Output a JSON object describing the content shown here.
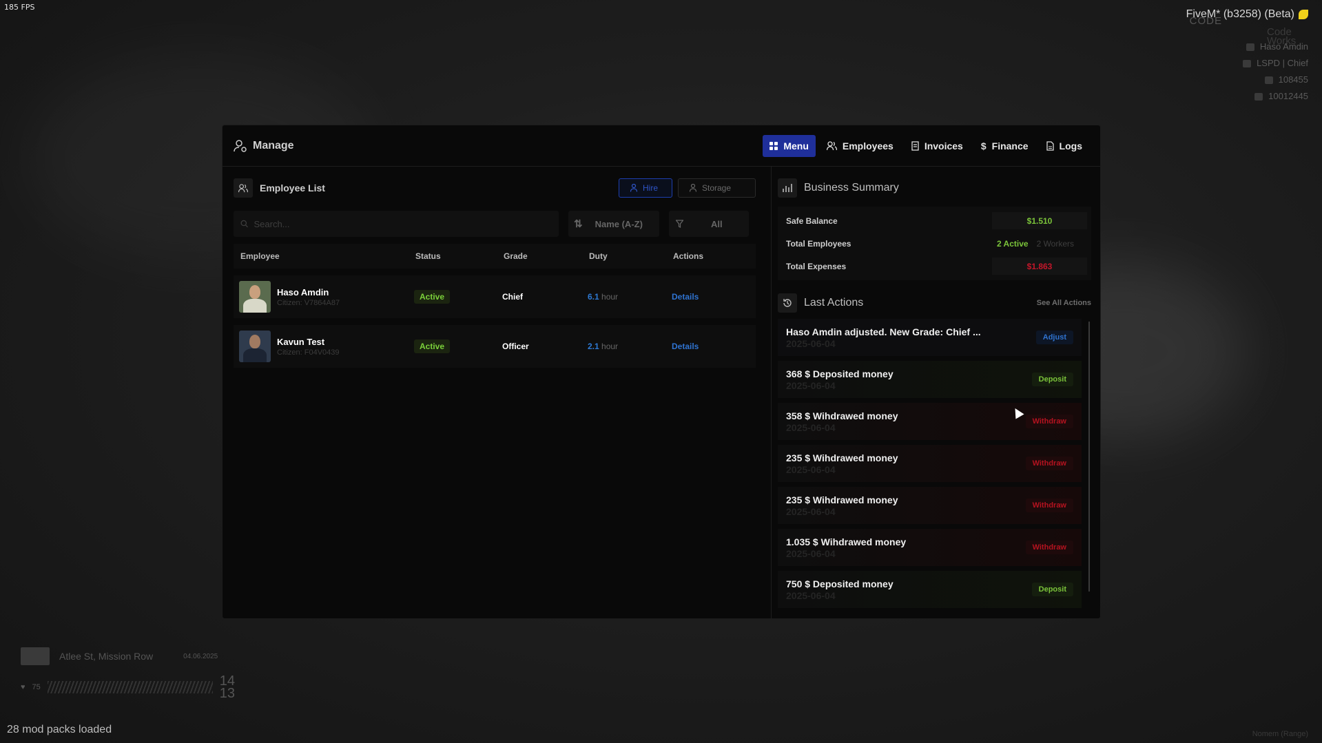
{
  "hud": {
    "fps": "185 FPS",
    "title": "FiveM* (b3258) (Beta)",
    "code_label": "CODE",
    "works_label": "Code Works",
    "player_name": "Haso Amdin",
    "job": "LSPD | Chief",
    "bank": "108455",
    "cash": "10012445",
    "street": "Atlee St, Mission Row",
    "date": "04.06.2025",
    "health": "75",
    "hunger": "14",
    "thirst": "13",
    "mods_loaded": "28 mod packs loaded",
    "native_label": "Nomem (Range)"
  },
  "panel": {
    "title": "Manage",
    "nav": [
      {
        "label": "Menu",
        "icon": "grid-icon",
        "active": true
      },
      {
        "label": "Employees",
        "icon": "users-icon",
        "active": false
      },
      {
        "label": "Invoices",
        "icon": "receipt-icon",
        "active": false
      },
      {
        "label": "Finance",
        "icon": "dollar-icon",
        "active": false
      },
      {
        "label": "Logs",
        "icon": "file-icon",
        "active": false
      }
    ]
  },
  "employee_list": {
    "title": "Employee List",
    "hire_label": "Hire",
    "storage_label": "Storage",
    "search_placeholder": "Search...",
    "sort_label": "Name (A-Z)",
    "filter_label": "All",
    "columns": [
      "Employee",
      "Status",
      "Grade",
      "Duty",
      "Actions"
    ],
    "rows": [
      {
        "name": "Haso Amdin",
        "citizen": "Citizen: V7864A87",
        "status": "Active",
        "grade": "Chief",
        "duty_value": "6.1",
        "duty_unit": "hour",
        "action": "Details"
      },
      {
        "name": "Kavun Test",
        "citizen": "Citizen: F04V0439",
        "status": "Active",
        "grade": "Officer",
        "duty_value": "2.1",
        "duty_unit": "hour",
        "action": "Details"
      }
    ]
  },
  "business_summary": {
    "title": "Business Summary",
    "safe_balance_label": "Safe Balance",
    "safe_balance_value": "$1.510",
    "total_employees_label": "Total Employees",
    "active_count": "2 Active",
    "workers_count": "2 Workers",
    "total_expenses_label": "Total Expenses",
    "total_expenses_value": "$1.863"
  },
  "last_actions": {
    "title": "Last Actions",
    "see_all": "See All Actions",
    "items": [
      {
        "text": "Haso Amdin adjusted. New Grade: Chief ...",
        "date": "2025-06-04",
        "type": "Adjust"
      },
      {
        "text": "368 $ Deposited money",
        "date": "2025-06-04",
        "type": "Deposit"
      },
      {
        "text": "358 $ Wihdrawed money",
        "date": "2025-06-04",
        "type": "Withdraw"
      },
      {
        "text": "235 $ Wihdrawed money",
        "date": "2025-06-04",
        "type": "Withdraw"
      },
      {
        "text": "235 $ Wihdrawed money",
        "date": "2025-06-04",
        "type": "Withdraw"
      },
      {
        "text": "1.035 $ Wihdrawed money",
        "date": "2025-06-04",
        "type": "Withdraw"
      },
      {
        "text": "750 $ Deposited money",
        "date": "2025-06-04",
        "type": "Deposit"
      }
    ]
  },
  "colors": {
    "accent": "#1f2f9a",
    "active_green": "#7bd13a",
    "withdraw_red": "#b5121f",
    "link_blue": "#2f73d0"
  }
}
